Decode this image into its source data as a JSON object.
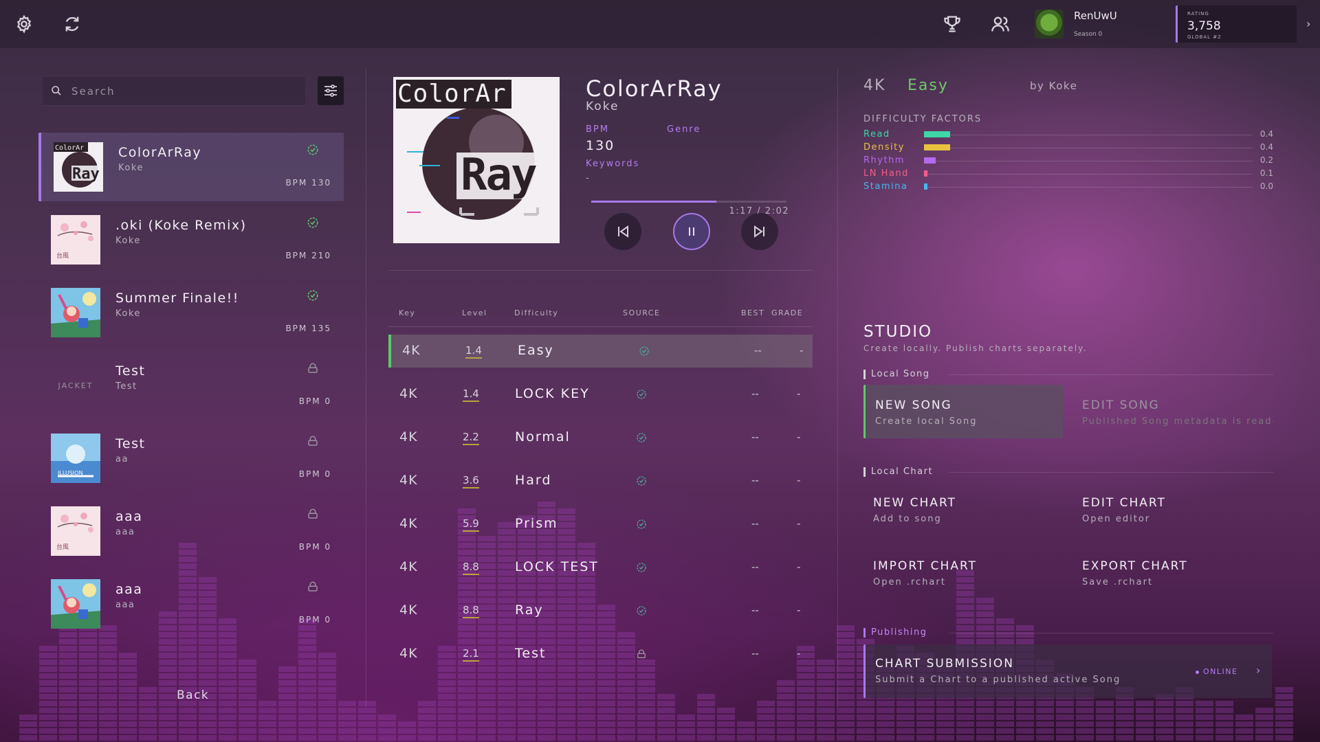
{
  "colors": {
    "accent": "#a879e8",
    "ok_green": "#5fc86c",
    "easy_green": "#6fc86a",
    "lock_gray": "#9a92a0"
  },
  "topbar": {
    "settings_icon": "gear-icon",
    "refresh_icon": "refresh-icon",
    "leaderboard_icon": "trophy-icon",
    "friends_icon": "users-icon",
    "profile": {
      "name": "RenUwU",
      "season": "Season 0"
    },
    "rating": {
      "label": "RATING",
      "value": "3,758",
      "global": "GLOBAL #2"
    }
  },
  "search": {
    "placeholder": "Search",
    "value": ""
  },
  "songs": [
    {
      "title": "ColorArRay",
      "artist": "Koke",
      "bpm": "BPM 130",
      "status": "check",
      "jacket": "colorarray",
      "selected": true
    },
    {
      "title": ".oki (Koke Remix)",
      "artist": "Koke",
      "bpm": "BPM 210",
      "status": "check",
      "jacket": "sakura",
      "selected": false
    },
    {
      "title": "Summer Finale!!",
      "artist": "Koke",
      "bpm": "BPM 135",
      "status": "check",
      "jacket": "summer",
      "selected": false
    },
    {
      "title": "Test",
      "artist": "Test",
      "bpm": "BPM 0",
      "status": "lock",
      "jacket": "none",
      "jacket_text": "JACKET",
      "selected": false
    },
    {
      "title": "Test",
      "artist": "aa",
      "bpm": "BPM 0",
      "status": "lock",
      "jacket": "blue",
      "selected": false
    },
    {
      "title": "aaa",
      "artist": "aaa",
      "bpm": "BPM 0",
      "status": "lock",
      "jacket": "sakura",
      "selected": false
    },
    {
      "title": "aaa",
      "artist": "aaa",
      "bpm": "BPM 0",
      "status": "lock",
      "jacket": "summer",
      "selected": false
    }
  ],
  "back_label": "Back",
  "now_playing": {
    "cover_text_top": "ColorAr",
    "cover_text_bottom": "Ray",
    "title": "ColorArRay",
    "artist": "Koke",
    "bpm_label": "BPM",
    "bpm": "130",
    "genre_label": "Genre",
    "genre": "",
    "keywords_label": "Keywords",
    "keywords": "-",
    "progress": 0.64,
    "time": "1:17 / 2:02"
  },
  "difficulty_table": {
    "headers": {
      "key": "Key",
      "level": "Level",
      "difficulty": "Difficulty",
      "source": "SOURCE",
      "best": "BEST",
      "grade": "GRADE"
    },
    "rows": [
      {
        "key": "4K",
        "level": "1.4",
        "name": "Easy",
        "source": "check",
        "best": "--",
        "grade": "-",
        "selected": true
      },
      {
        "key": "4K",
        "level": "1.4",
        "name": "LOCK KEY",
        "source": "check",
        "best": "--",
        "grade": "-"
      },
      {
        "key": "4K",
        "level": "2.2",
        "name": "Normal",
        "source": "check",
        "best": "--",
        "grade": "-"
      },
      {
        "key": "4K",
        "level": "3.6",
        "name": "Hard",
        "source": "check",
        "best": "--",
        "grade": "-"
      },
      {
        "key": "4K",
        "level": "5.9",
        "name": "Prism",
        "source": "check",
        "best": "--",
        "grade": "-"
      },
      {
        "key": "4K",
        "level": "8.8",
        "name": "LOCK TEST",
        "source": "check",
        "best": "--",
        "grade": "-"
      },
      {
        "key": "4K",
        "level": "8.8",
        "name": "Ray",
        "source": "check",
        "best": "--",
        "grade": "-"
      },
      {
        "key": "4K",
        "level": "2.1",
        "name": "Test",
        "source": "lock",
        "best": "--",
        "grade": "-"
      }
    ]
  },
  "chart_info": {
    "key": "4K",
    "difficulty": "Easy",
    "by": "by Koke",
    "factors_title": "DIFFICULTY FACTORS",
    "factors": [
      {
        "name": "Read",
        "value": "0.4",
        "level": 0.08,
        "color": "#3fd6a8"
      },
      {
        "name": "Density",
        "value": "0.4",
        "level": 0.08,
        "color": "#e8c23e"
      },
      {
        "name": "Rhythm",
        "value": "0.2",
        "level": 0.035,
        "color": "#b36af0"
      },
      {
        "name": "LN Hand",
        "value": "0.1",
        "level": 0.01,
        "color": "#f0608a"
      },
      {
        "name": "Stamina",
        "value": "0.0",
        "level": 0.008,
        "color": "#48b8ee"
      }
    ]
  },
  "studio": {
    "title": "STUDIO",
    "subtitle": "Create locally. Publish charts separately.",
    "local_song_label": "Local Song",
    "new_song": {
      "title": "NEW SONG",
      "sub": "Create local Song"
    },
    "edit_song": {
      "title": "EDIT SONG",
      "sub": "Published Song metadata is read-c"
    },
    "local_chart_label": "Local Chart",
    "new_chart": {
      "title": "NEW CHART",
      "sub": "Add to song"
    },
    "edit_chart": {
      "title": "EDIT CHART",
      "sub": "Open editor"
    },
    "import_chart": {
      "title": "IMPORT CHART",
      "sub": "Open .rchart"
    },
    "export_chart": {
      "title": "EXPORT CHART",
      "sub": "Save .rchart"
    },
    "publishing_label": "Publishing",
    "submission": {
      "title": "CHART SUBMISSION",
      "sub": "Submit a Chart to a published active Song",
      "status": "ONLINE"
    }
  }
}
